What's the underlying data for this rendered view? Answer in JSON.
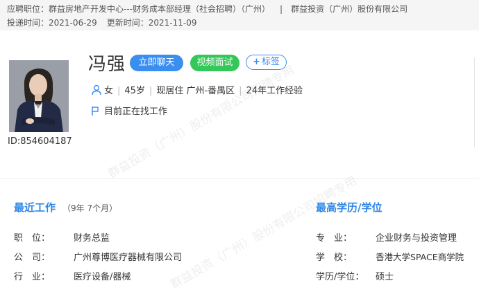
{
  "header": {
    "position_label": "应聘职位：",
    "position_value": "群益房地产开发中心---财务成本部经理（社会招聘）（广州）",
    "separator": "|",
    "company": "群益投资（广州）股份有限公司",
    "delivery_label": "投递时间：",
    "delivery_value": "2021-06-29",
    "update_label": "更新时间：",
    "update_value": "2021-11-09"
  },
  "candidate": {
    "name": "冯强",
    "id_label": "ID:854604187",
    "gender": "女",
    "age": "45岁",
    "residence": "现居住 广州-番禺区",
    "experience": "24年工作经验",
    "status": "目前正在找工作"
  },
  "actions": {
    "chat": "立即聊天",
    "video": "视频面试",
    "tag": "标签",
    "tag_plus": "+"
  },
  "watermark": {
    "text": "群益投资（广州）股份有限公司招聘专用"
  },
  "recent_work": {
    "title": "最近工作",
    "duration": "（9年 7个月）",
    "rows": [
      {
        "label": "职　位：",
        "value": "财务总监"
      },
      {
        "label": "公　司：",
        "value": "广州尊博医疗器械有限公司"
      },
      {
        "label": "行　业：",
        "value": "医疗设备/器械"
      }
    ]
  },
  "education": {
    "title": "最高学历/学位",
    "rows": [
      {
        "label": "专　业：",
        "value": "企业财务与投资管理"
      },
      {
        "label": "学　校：",
        "value": "香港大学SPACE商学院"
      },
      {
        "label": "学历/学位：",
        "value": "硕士"
      }
    ]
  },
  "colors": {
    "accent": "#2f87e6",
    "chat_button": "#3a8ef0",
    "video_button": "#34c759"
  }
}
